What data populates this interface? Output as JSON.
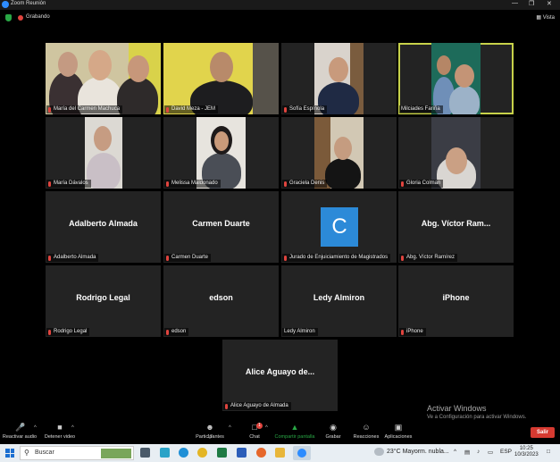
{
  "window": {
    "title": "Zoom Reunión",
    "minimize": "—",
    "maximize": "❐",
    "close": "✕"
  },
  "topbar": {
    "recording": "Grabando",
    "view": "Vista"
  },
  "tiles": [
    {
      "name": "María del Carmen Machuca"
    },
    {
      "name": "David Meza - JEM"
    },
    {
      "name": "Sofía Espínola"
    },
    {
      "name": "Milciades Fariña"
    },
    {
      "name": "María Dávalos"
    },
    {
      "name": "Melissa Maldonado"
    },
    {
      "name": "Graciela Denis"
    },
    {
      "name": "Gloria Colman"
    },
    {
      "name": "Adalberto Almada",
      "display": "Adalberto Almada"
    },
    {
      "name": "Carmen Duarte",
      "display": "Carmen Duarte"
    },
    {
      "name": "Jurado de Enjuiciamiento de Magistrados",
      "avatar_letter": "C"
    },
    {
      "name": "Abg. Víctor Ramírez",
      "display": "Abg. Víctor Ram..."
    },
    {
      "name": "Rodrigo Legal",
      "display": "Rodrigo Legal"
    },
    {
      "name": "edson",
      "display": "edson"
    },
    {
      "name": "Ledy Almiron",
      "display": "Ledy Almiron"
    },
    {
      "name": "iPhone",
      "display": "iPhone"
    },
    {
      "name": "Alice Aguayo de Almada",
      "display": "Alice Aguayo de..."
    }
  ],
  "watermark": {
    "line1": "Activar Windows",
    "line2": "Ve a Configuración para activar Windows."
  },
  "toolbar": {
    "audio": "Reactivar audio",
    "video": "Detener video",
    "participants": "Participantes",
    "participants_count": "17",
    "chat": "Chat",
    "chat_badge": "1",
    "share": "Compartir pantalla",
    "record": "Grabar",
    "reactions": "Reacciones",
    "apps": "Aplicaciones",
    "leave": "Salir"
  },
  "taskbar": {
    "search_placeholder": "Buscar",
    "temperature": "23°C",
    "weather": "Mayorm. nubla...",
    "language": "ESP",
    "time": "10:25",
    "date": "10/3/2023"
  },
  "colors": {
    "accent": "#2d8cff",
    "active_speaker": "#c8d24a",
    "leave": "#d63a31",
    "share": "#29a745"
  }
}
